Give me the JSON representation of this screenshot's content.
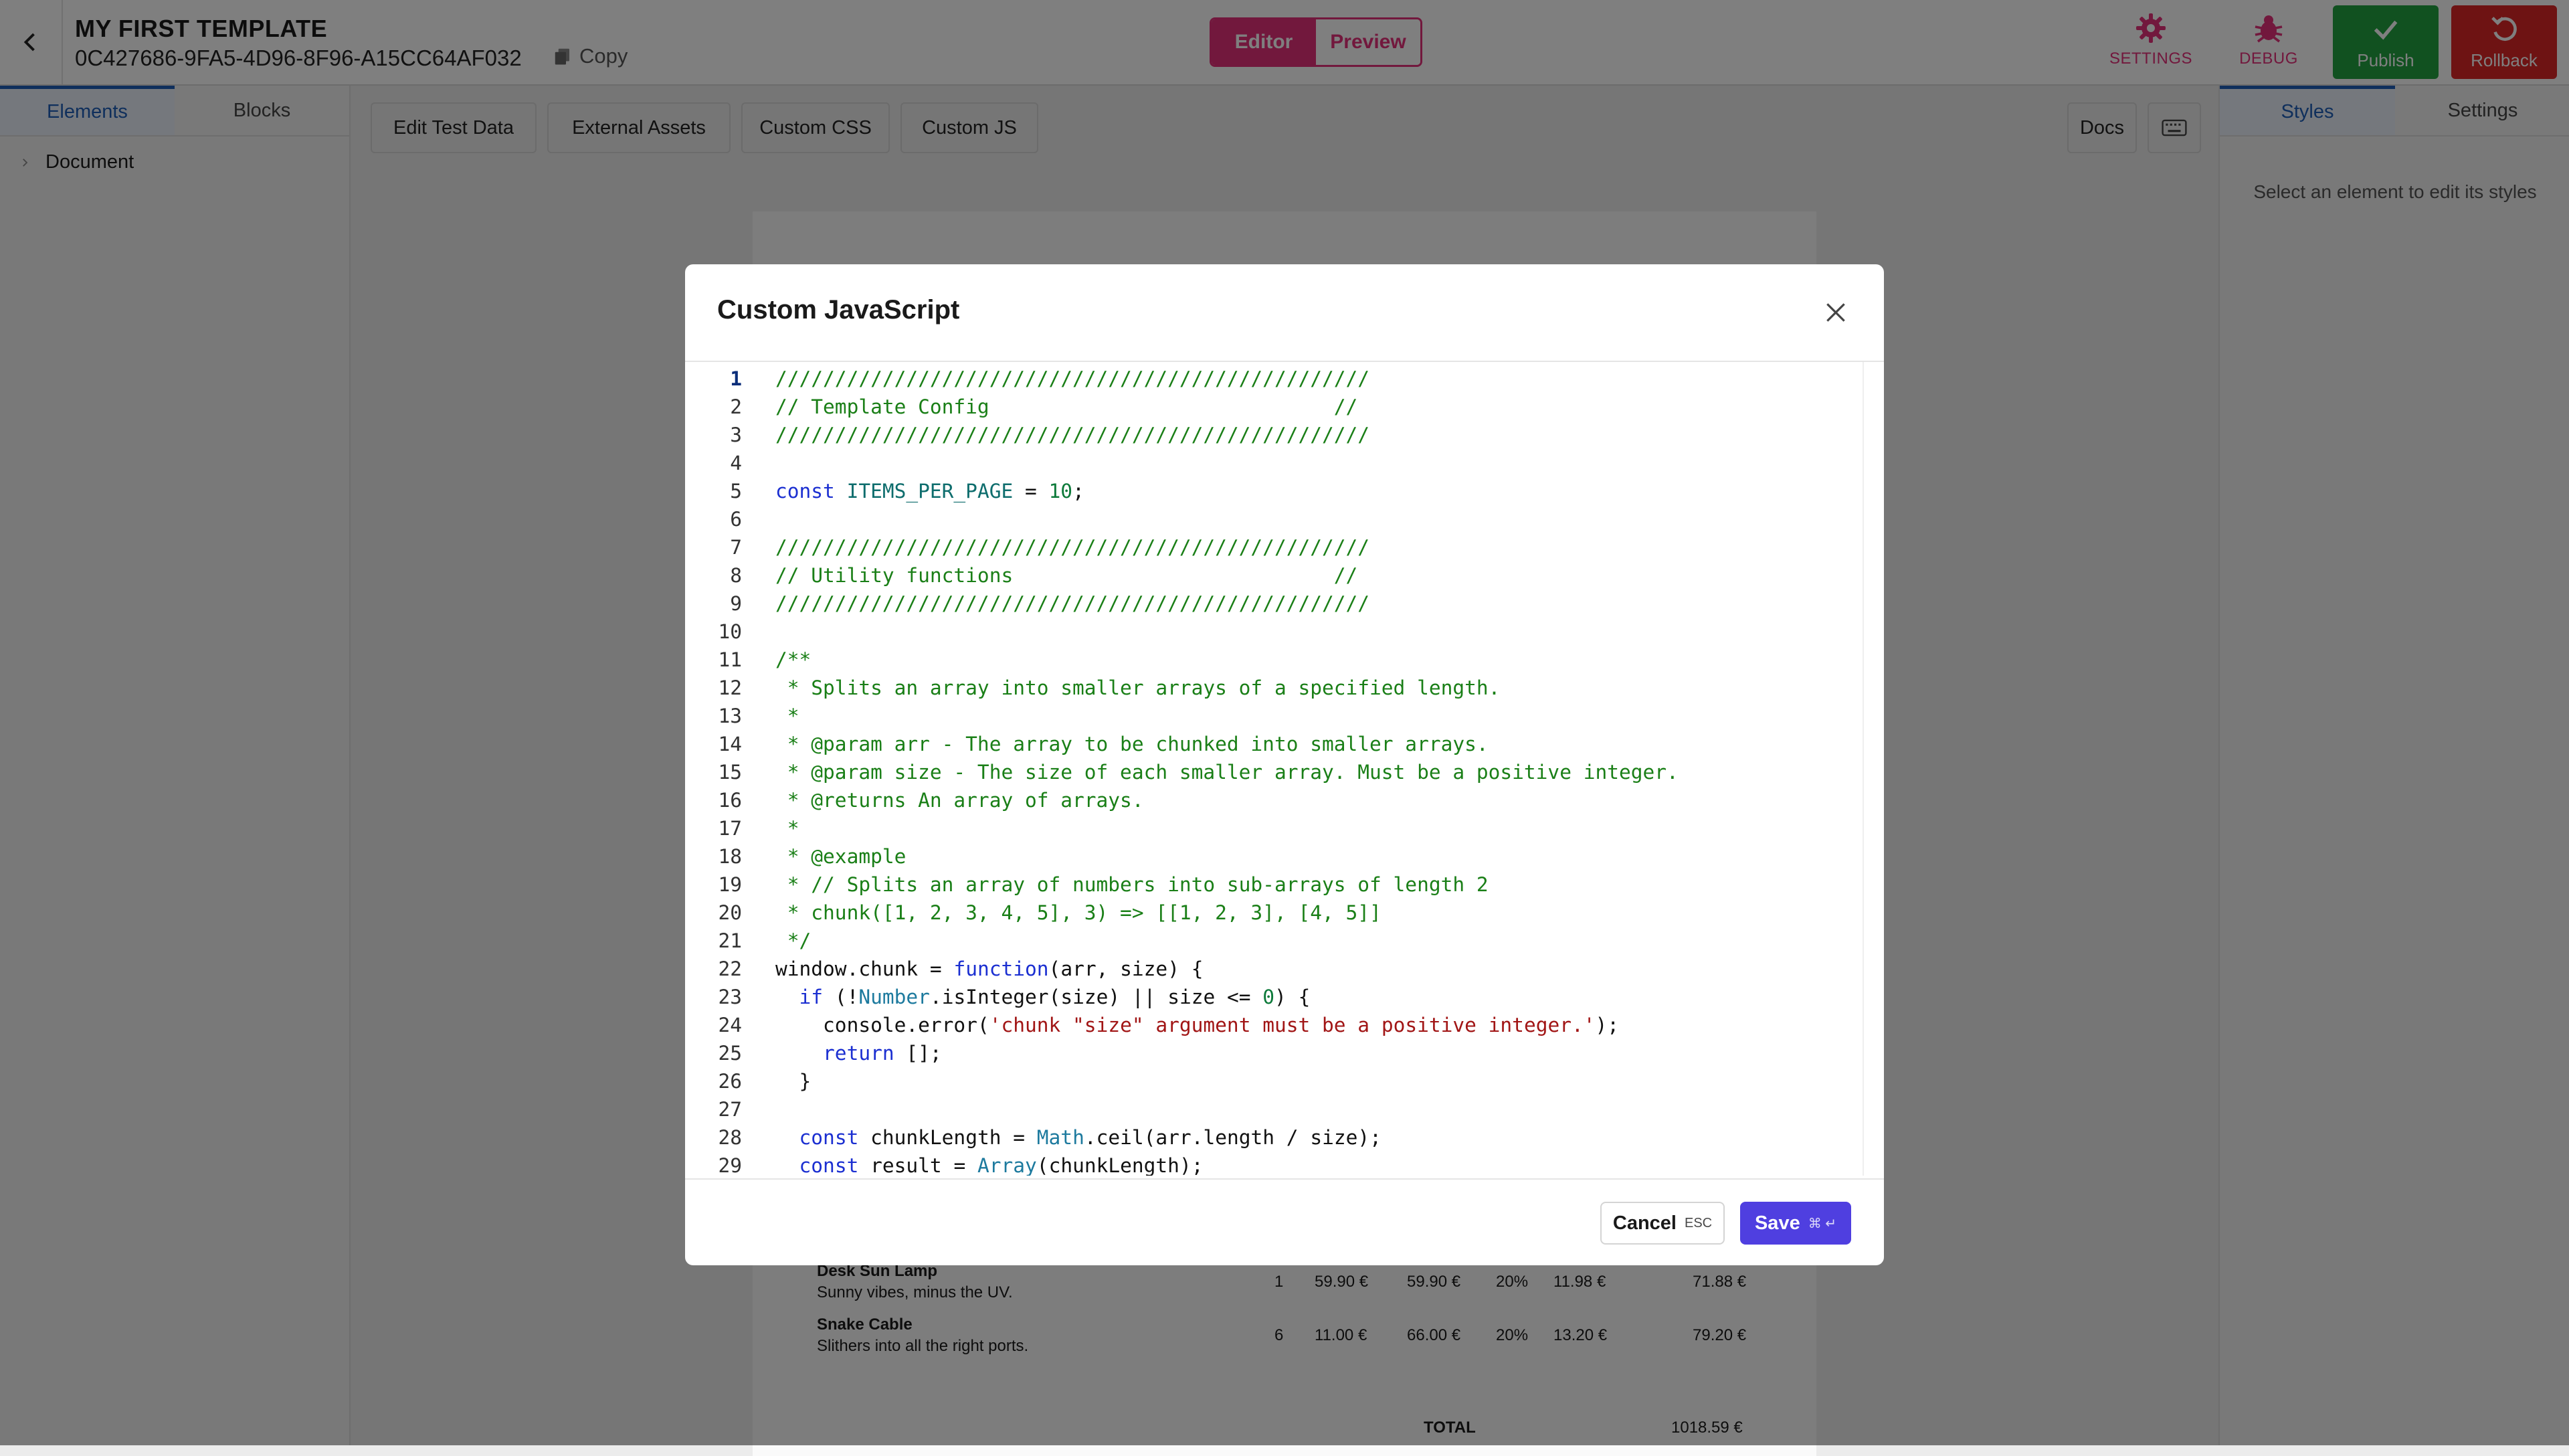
{
  "header": {
    "template_name": "MY FIRST TEMPLATE",
    "template_id": "0C427686-9FA5-4D96-8F96-A15CC64AF032",
    "copy_label": "Copy",
    "mode_editor": "Editor",
    "mode_preview": "Preview",
    "settings_label": "SETTINGS",
    "debug_label": "DEBUG",
    "publish_label": "Publish",
    "rollback_label": "Rollback"
  },
  "left_panel": {
    "tabs": [
      "Elements",
      "Blocks"
    ],
    "active_tab": "Elements",
    "tree_root": "Document"
  },
  "toolbar": {
    "edit_test_data": "Edit Test Data",
    "external_assets": "External Assets",
    "custom_css": "Custom CSS",
    "custom_js": "Custom JS",
    "docs": "Docs",
    "keyboard_icon": "keyboard-icon"
  },
  "right_panel": {
    "tabs": [
      "Styles",
      "Settings"
    ],
    "active_tab": "Styles",
    "empty_text": "Select an element to edit its styles"
  },
  "invoice_preview": {
    "rows": [
      {
        "name": "Desk Sun Lamp",
        "desc": "Sunny vibes, minus the UV.",
        "qty": "1",
        "unit": "59.90 €",
        "net": "59.90 €",
        "vat_rate": "20%",
        "vat": "11.98 €",
        "total": "71.88 €"
      },
      {
        "name": "Snake Cable",
        "desc": "Slithers into all the right ports.",
        "qty": "6",
        "unit": "11.00 €",
        "net": "66.00 €",
        "vat_rate": "20%",
        "vat": "13.20 €",
        "total": "79.20 €"
      }
    ],
    "total_label": "TOTAL",
    "total_value": "1018.59 €"
  },
  "modal": {
    "title": "Custom JavaScript",
    "cancel_label": "Cancel",
    "cancel_shortcut": "ESC",
    "save_label": "Save",
    "save_shortcut": "⌘ ↵",
    "code_lines": [
      "//////////////////////////////////////////////////",
      "// Template Config                             //",
      "//////////////////////////////////////////////////",
      "",
      "const ITEMS_PER_PAGE = 10;",
      "",
      "//////////////////////////////////////////////////",
      "// Utility functions                           //",
      "//////////////////////////////////////////////////",
      "",
      "/**",
      " * Splits an array into smaller arrays of a specified length.",
      " *",
      " * @param arr - The array to be chunked into smaller arrays.",
      " * @param size - The size of each smaller array. Must be a positive integer.",
      " * @returns An array of arrays.",
      " *",
      " * @example",
      " * // Splits an array of numbers into sub-arrays of length 2",
      " * chunk([1, 2, 3, 4, 5], 3) => [[1, 2, 3], [4, 5]]",
      " */",
      "window.chunk = function(arr, size) {",
      "  if (!Number.isInteger(size) || size <= 0) {",
      "    console.error('chunk \"size\" argument must be a positive integer.');",
      "    return [];",
      "  }",
      "",
      "  const chunkLength = Math.ceil(arr.length / size);",
      "  const result = Array(chunkLength);"
    ]
  }
}
